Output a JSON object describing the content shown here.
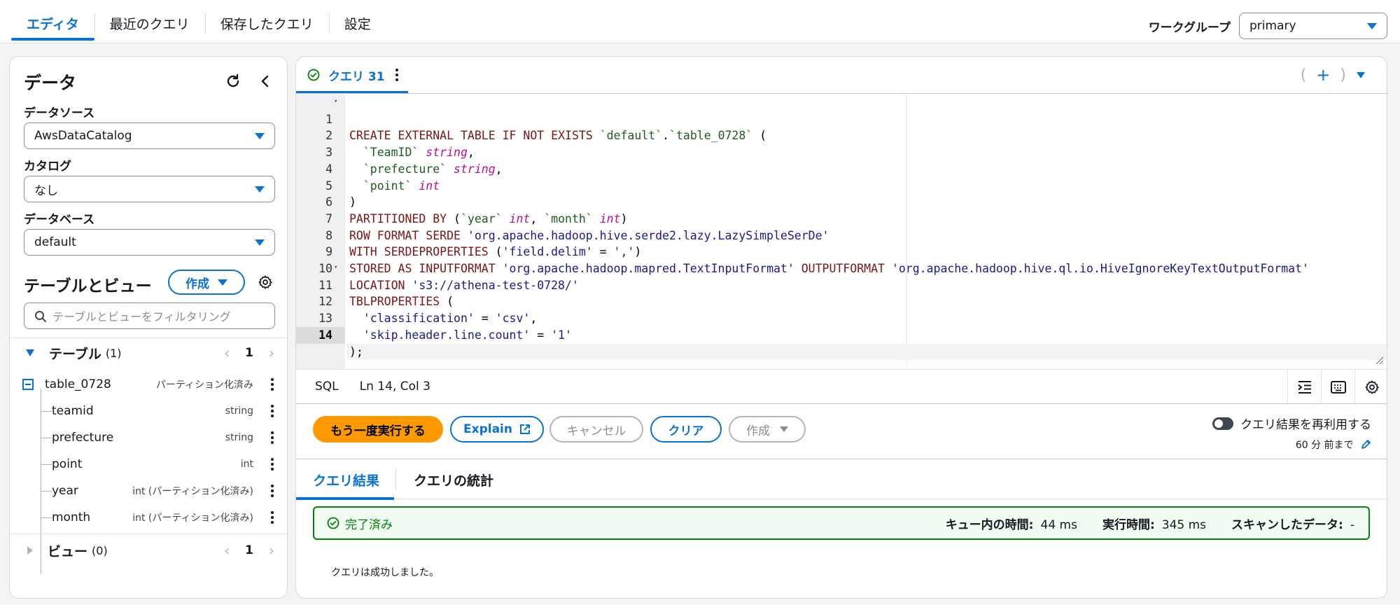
{
  "top_tabs": [
    {
      "label": "エディタ",
      "active": true
    },
    {
      "label": "最近のクエリ",
      "active": false
    },
    {
      "label": "保存したクエリ",
      "active": false
    },
    {
      "label": "設定",
      "active": false
    }
  ],
  "workgroup": {
    "label": "ワークグループ",
    "value": "primary"
  },
  "data_panel": {
    "title": "データ",
    "data_source": {
      "label": "データソース",
      "value": "AwsDataCatalog"
    },
    "catalog": {
      "label": "カタログ",
      "value": "なし"
    },
    "database": {
      "label": "データベース",
      "value": "default"
    },
    "tables_views_title": "テーブルとビュー",
    "create_label": "作成",
    "filter_placeholder": "テーブルとビューをフィルタリング",
    "tables_group": {
      "label": "テーブル",
      "count": "(1)",
      "page": "1"
    },
    "table": {
      "name": "table_0728",
      "note": "パーティション化済み"
    },
    "columns": [
      {
        "name": "teamid",
        "type": "string"
      },
      {
        "name": "prefecture",
        "type": "string"
      },
      {
        "name": "point",
        "type": "int"
      },
      {
        "name": "year",
        "type": "int (パーティション化済み)"
      },
      {
        "name": "month",
        "type": "int (パーティション化済み)"
      }
    ],
    "views_group": {
      "label": "ビュー",
      "count": "(0)",
      "page": "1"
    }
  },
  "editor": {
    "tab_label": "クエリ 31",
    "language": "SQL",
    "cursor_position": "Ln 14, Col 3",
    "active_line": 14,
    "lines": [
      "CREATE EXTERNAL TABLE IF NOT EXISTS `default`.`table_0728` (",
      "  `TeamID` string,",
      "  `prefecture` string,",
      "  `point` int",
      ")",
      "PARTITIONED BY (`year` int, `month` int)",
      "ROW FORMAT SERDE 'org.apache.hadoop.hive.serde2.lazy.LazySimpleSerDe'",
      "WITH SERDEPROPERTIES ('field.delim' = ',')",
      "STORED AS INPUTFORMAT 'org.apache.hadoop.mapred.TextInputFormat' OUTPUTFORMAT 'org.apache.hadoop.hive.ql.io.HiveIgnoreKeyTextOutputFormat'",
      "LOCATION 's3://athena-test-0728/'",
      "TBLPROPERTIES (",
      "  'classification' = 'csv',",
      "  'skip.header.line.count' = '1'",
      ");"
    ]
  },
  "actions": {
    "rerun_label": "もう一度実行する",
    "explain_label": "Explain",
    "cancel_label": "キャンセル",
    "clear_label": "クリア",
    "create_label": "作成",
    "reuse_label": "クエリ結果を再利用する",
    "reuse_sub": "60 分 前まで"
  },
  "results": {
    "tabs": [
      "クエリ結果",
      "クエリの統計"
    ],
    "status": "完了済み",
    "queue_time_label": "キュー内の時間:",
    "queue_time": "44 ms",
    "run_time_label": "実行時間:",
    "run_time": "345 ms",
    "scanned_label": "スキャンしたデータ:",
    "scanned": "-",
    "message": "クエリは成功しました。"
  },
  "colors": {
    "accent": "#0972d3",
    "primary_button": "#ff9900",
    "success": "#037f0c"
  }
}
